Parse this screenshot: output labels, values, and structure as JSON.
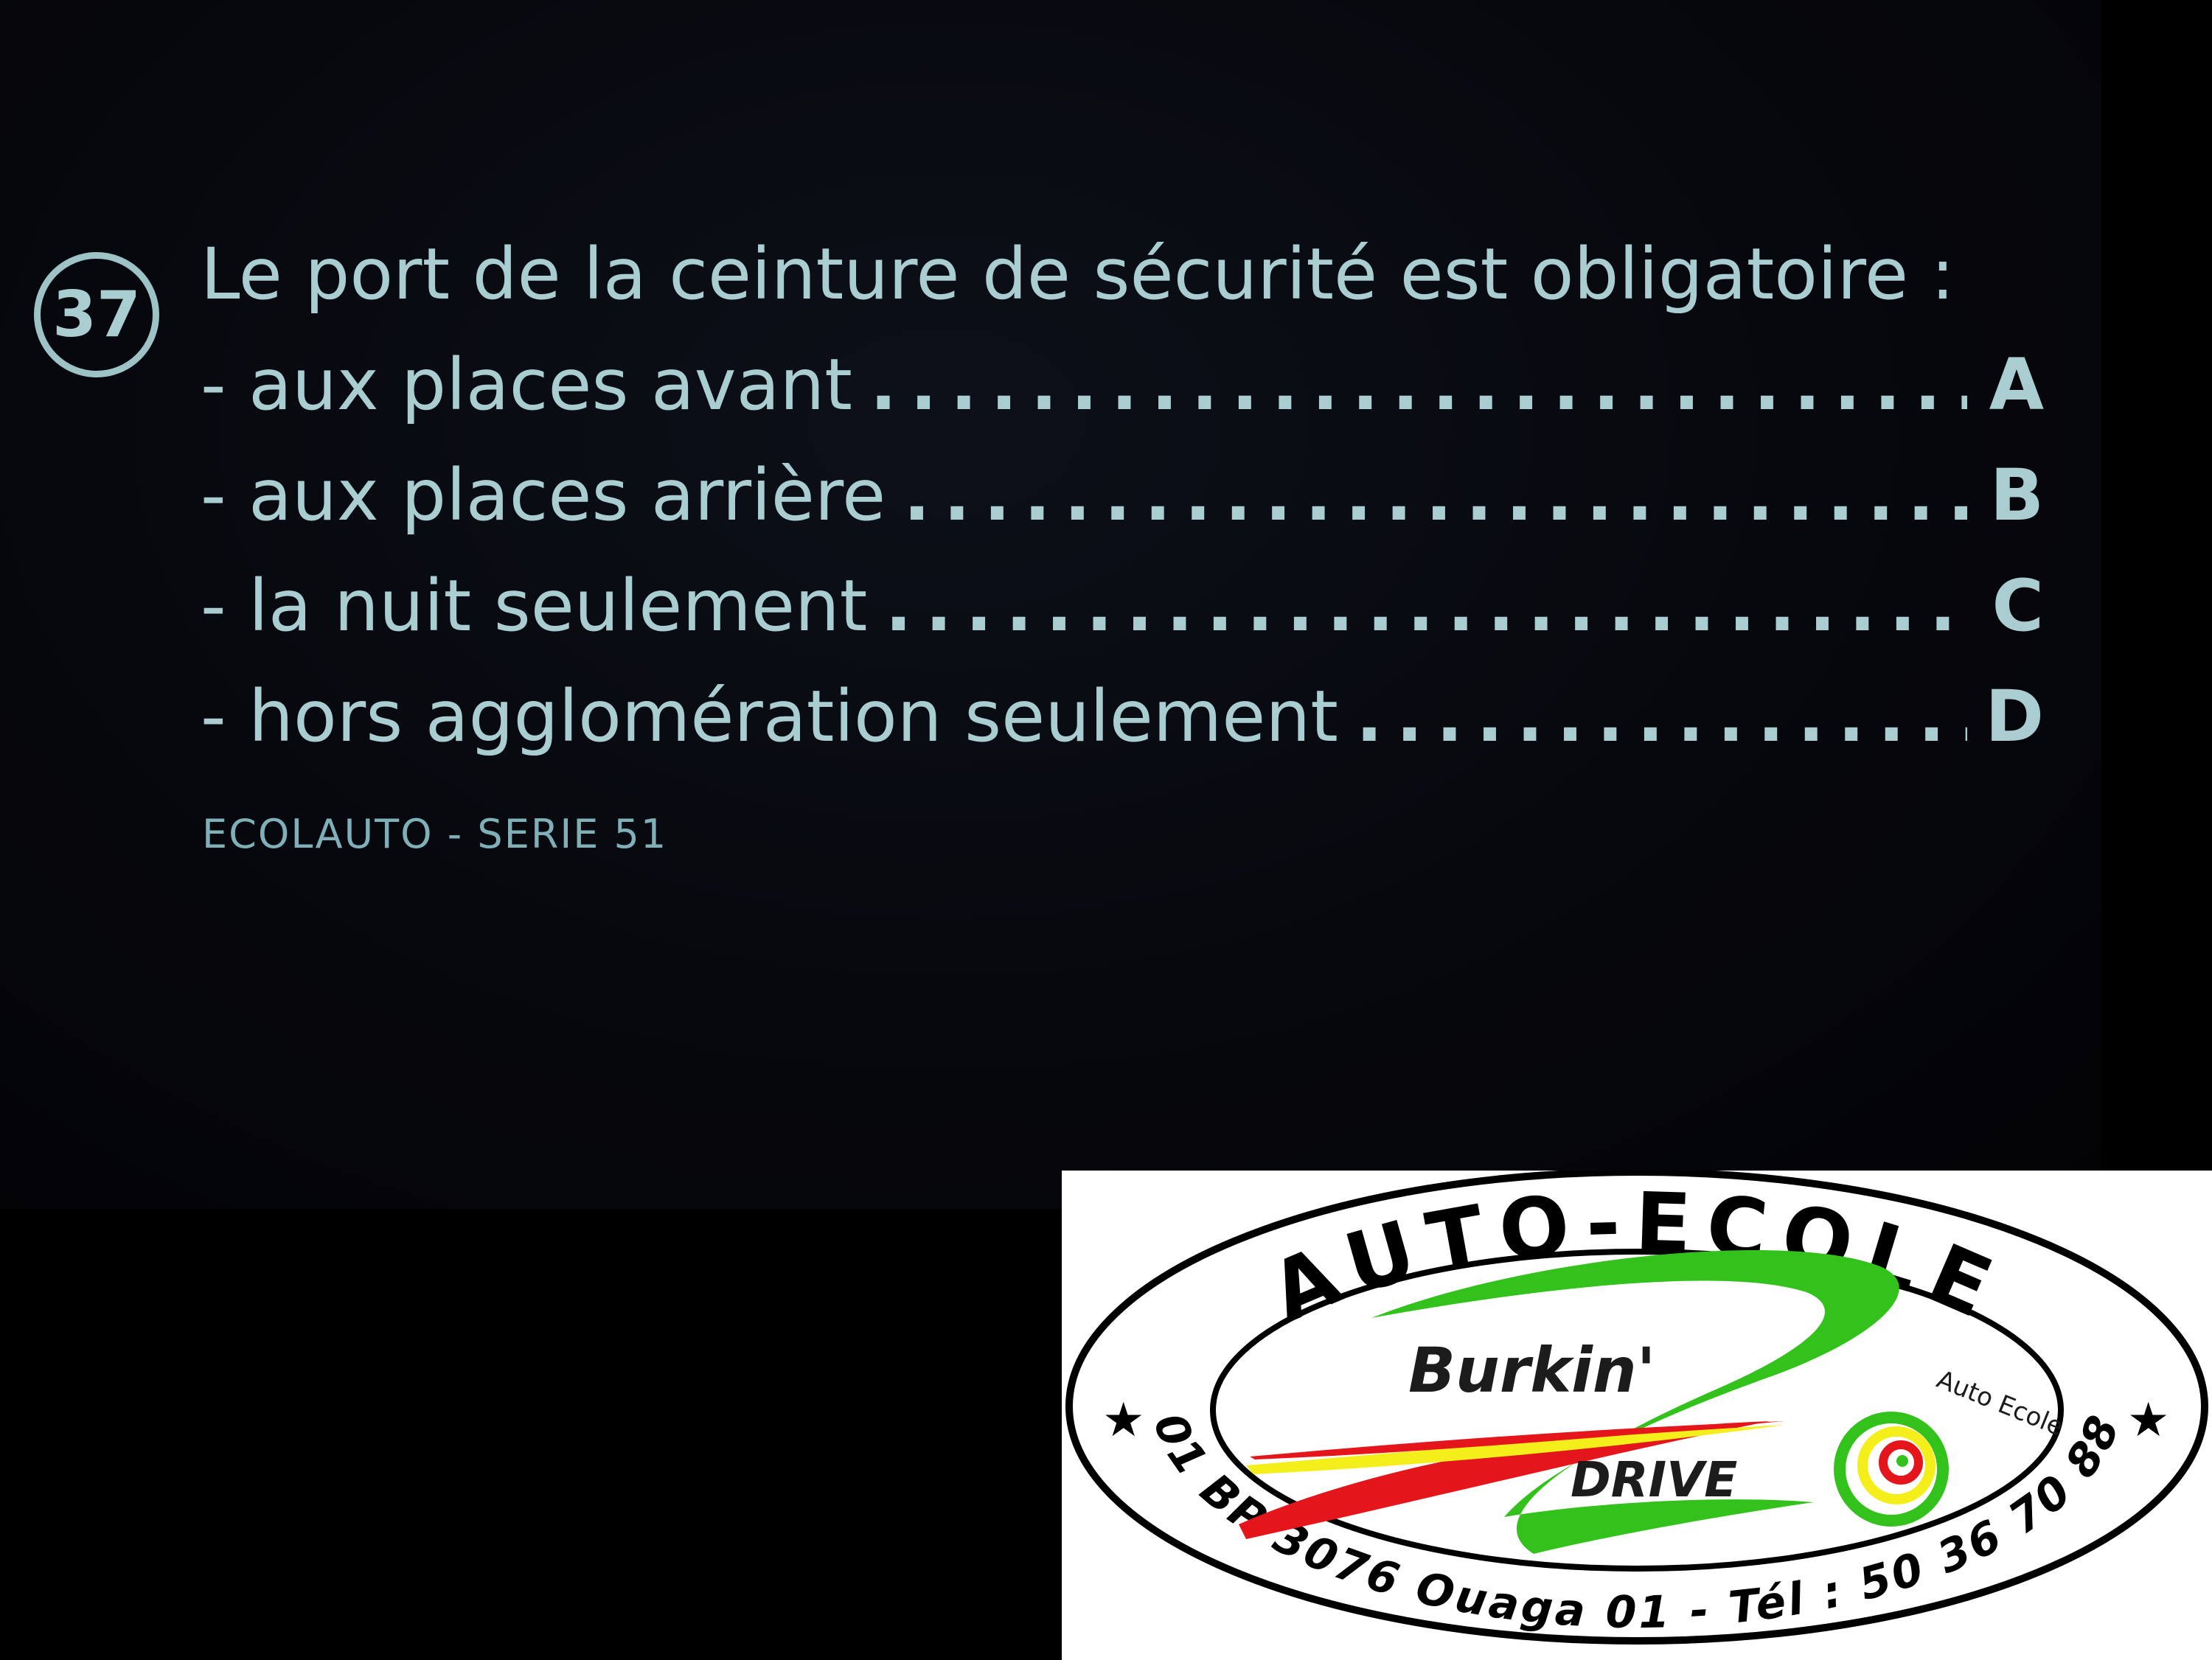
{
  "question": {
    "number": "37",
    "text": "Le port de la ceinture de sécurité est obligatoire :",
    "answers": [
      {
        "text": "- aux places avant",
        "letter": "A"
      },
      {
        "text": "- aux places arrière",
        "letter": "B"
      },
      {
        "text": "- la nuit seulement",
        "letter": "C"
      },
      {
        "text": "- hors agglomération seulement",
        "letter": "D"
      }
    ],
    "dots": "................................................",
    "source": "ECOLAUTO - SERIE 51"
  },
  "logo": {
    "arc_top": "AUTO-ECOLE",
    "brand_line1": "Burkin'",
    "brand_line2": "DRIVE",
    "tagline": "Auto Ecole",
    "arc_bottom": "01 BP 3076 Ouaga 01 - Tél : 50 36 70 88",
    "star_left": "★",
    "star_right": "★",
    "colors": {
      "green": "#33c21c",
      "red": "#e4161b",
      "yellow": "#f4ef1a",
      "black": "#000000"
    }
  }
}
